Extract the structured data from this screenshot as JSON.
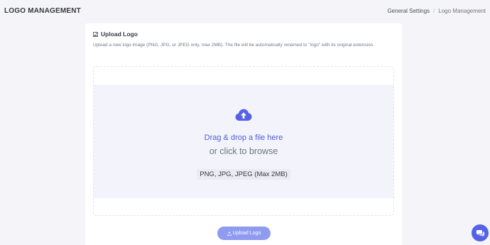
{
  "header": {
    "title": "LOGO MANAGEMENT",
    "breadcrumb": {
      "parent": "General Settings",
      "separator": "/",
      "current": "Logo Management"
    }
  },
  "card": {
    "title": "Upload Logo",
    "title_icon": "image-icon",
    "description": "Upload a new logo image (PNG, JPG, or JPEG only, max 2MB). The file will be automatically renamed to \"logo\" with its original extension."
  },
  "dropzone": {
    "icon": "cloud-upload-icon",
    "drag_text": "Drag & drop a file here",
    "browse_text": "or click to browse",
    "formats_text": "PNG, JPG, JPEG (Max 2MB)"
  },
  "upload_button": {
    "label": "Upload Logo",
    "icon": "upload-icon"
  },
  "chat": {
    "icon": "chat-icon"
  },
  "colors": {
    "page_bg": "#f5f5f9",
    "accent": "#5562e6",
    "accent_text": "#4f5bd5",
    "button_bg": "#8f9bf0",
    "dropzone_bg": "#f3f4fb"
  }
}
